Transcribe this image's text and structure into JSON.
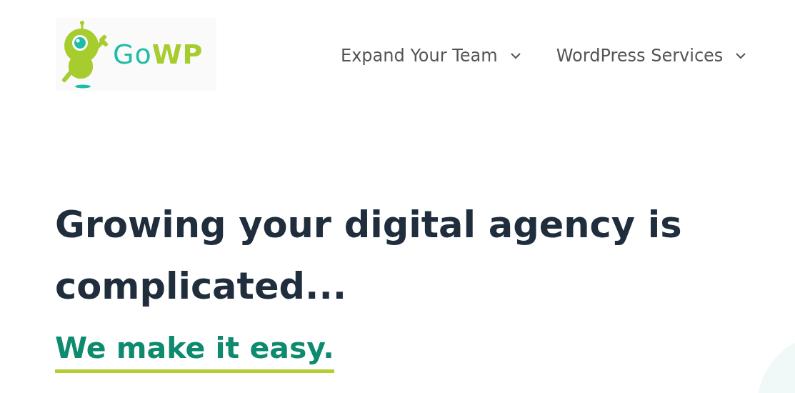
{
  "logo": {
    "text": "Go**WP**"
  },
  "nav": [
    {
      "label": "Expand Your Team"
    },
    {
      "label": "WordPress Services"
    }
  ],
  "hero": {
    "heading": "Growing your digital agency is complicated...",
    "subheading": "We make it easy."
  }
}
